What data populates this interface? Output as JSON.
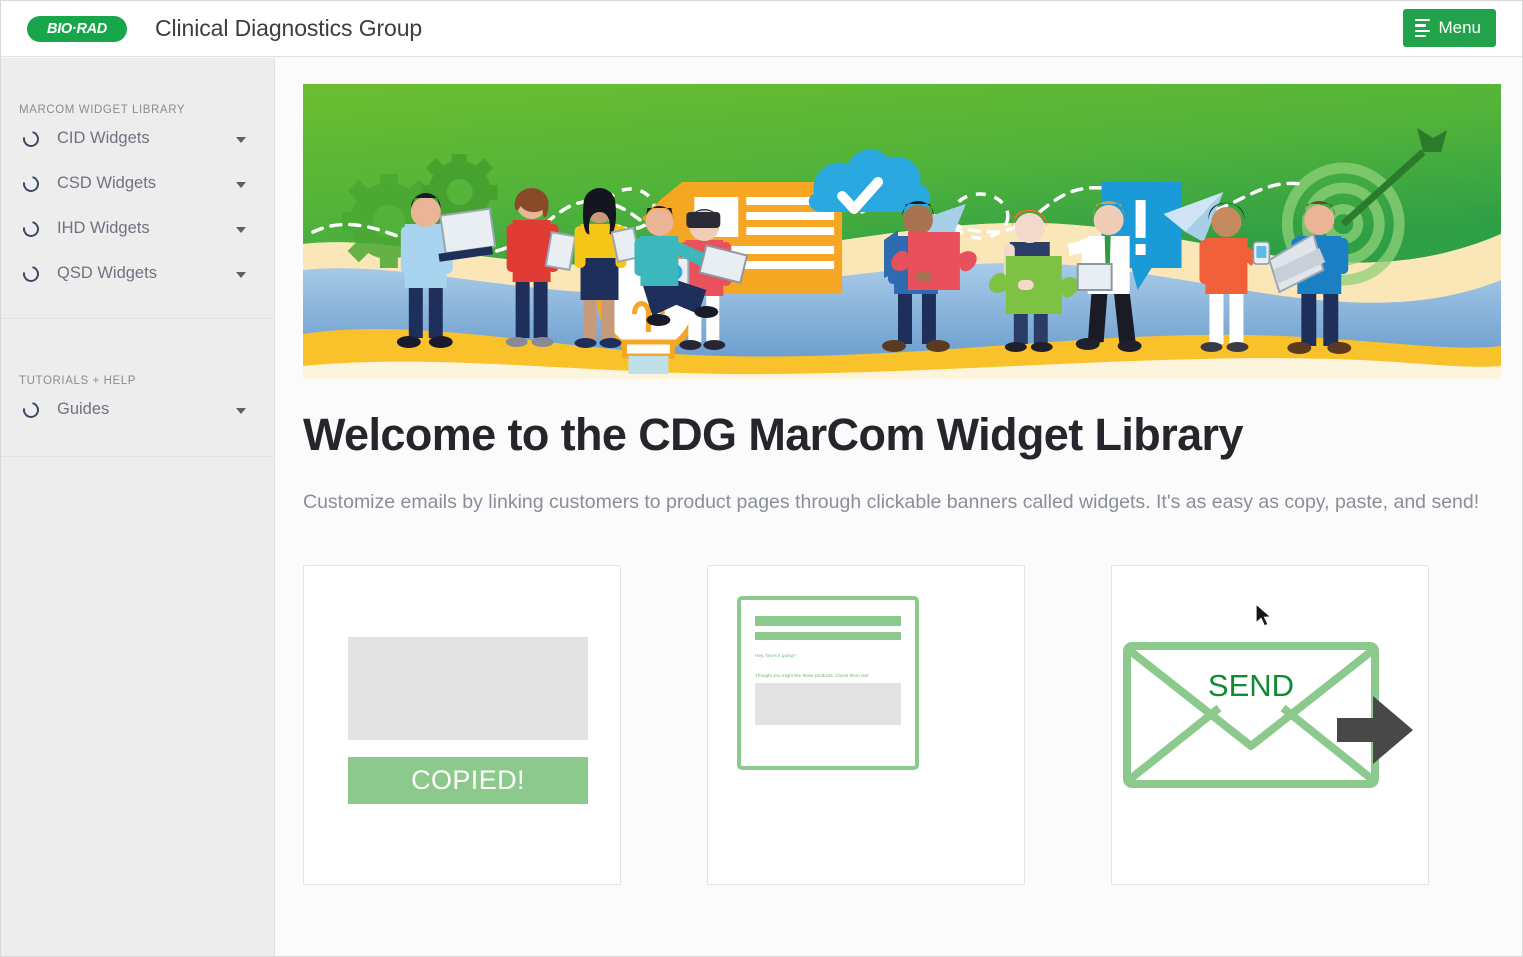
{
  "header": {
    "logo_text": "BIO·RAD",
    "logo_color": "#17a74a",
    "app_title": "Clinical Diagnostics Group",
    "menu_label": "Menu",
    "menu_color": "#22a34b"
  },
  "sidebar": {
    "groups": [
      {
        "label": "MARCOM WIDGET LIBRARY",
        "items": [
          {
            "label": "CID Widgets"
          },
          {
            "label": "CSD Widgets"
          },
          {
            "label": "IHD Widgets"
          },
          {
            "label": "QSD Widgets"
          }
        ]
      },
      {
        "label": "TUTORIALS + HELP",
        "items": [
          {
            "label": "Guides"
          }
        ]
      }
    ]
  },
  "main": {
    "page_title": "Welcome to the CDG MarCom Widget Library",
    "page_desc": "Customize emails by linking customers to product pages through clickable banners called widgets. It's as easy as copy, paste, and send!",
    "cards": [
      {
        "name": "copy-card",
        "button_label": "COPIED!",
        "button_color": "#8cc98c"
      },
      {
        "name": "paste-card",
        "mail_line1": "Hey, how's it going?",
        "mail_line2": "Thought you might like these products. Check them out!",
        "accent_color": "#8cc98c"
      },
      {
        "name": "send-card",
        "envelope_label": "SEND",
        "envelope_color": "#8cc98c",
        "label_color": "#118a34",
        "arrow_color": "#484848"
      }
    ]
  },
  "hero": {
    "alt": "illustration of business people collaborating with devices over green, blue and yellow waves"
  }
}
